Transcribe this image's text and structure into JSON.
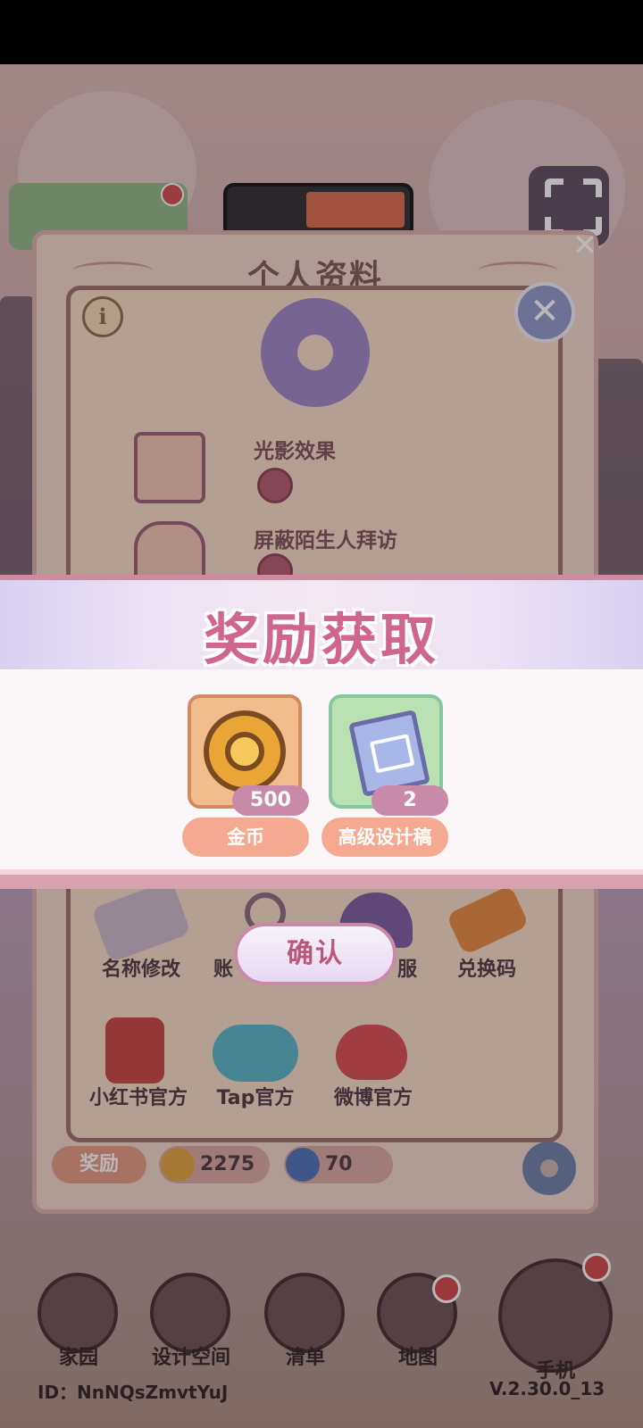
{
  "profile_panel": {
    "title": "个人资料",
    "info_glyph": "i",
    "close_glyph": "✕",
    "settings": [
      {
        "label": "光影效果",
        "icon": "light-switch-icon"
      },
      {
        "label": "屏蔽陌生人拜访",
        "icon": "house-block-icon"
      }
    ],
    "grid_row1": [
      {
        "label": "名称修改",
        "icon": "pencil-icon"
      },
      {
        "label": "账",
        "icon": "account-icon"
      },
      {
        "label": "服",
        "icon": "headset-icon"
      },
      {
        "label": "兑换码",
        "icon": "ticket-icon"
      }
    ],
    "grid_row2": [
      {
        "label": "小红书官方",
        "icon": "red-book-icon"
      },
      {
        "label": "Tap官方",
        "icon": "tap-icon"
      },
      {
        "label": "微博官方",
        "icon": "weibo-icon"
      }
    ],
    "reward_label": "奖励",
    "coins": "2275",
    "swirl": "70"
  },
  "reward_popup": {
    "title": "奖励获取",
    "items": [
      {
        "name": "金币",
        "count": "500",
        "icon": "coin-icon"
      },
      {
        "name": "高级设计稿",
        "count": "2",
        "icon": "design-scroll-icon"
      }
    ],
    "confirm_label": "确认"
  },
  "bottom_nav": [
    {
      "label": "家园",
      "icon": "home-icon"
    },
    {
      "label": "设计空间",
      "icon": "design-space-icon"
    },
    {
      "label": "清单",
      "icon": "checklist-icon"
    },
    {
      "label": "地图",
      "icon": "map-pin-icon"
    },
    {
      "label": "手机",
      "icon": "phone-icon"
    }
  ],
  "footer": {
    "user_id": "ID：NnNQsZmvtYuJ",
    "version": "V.2.30.0_13"
  },
  "colors": {
    "accent_pink": "#d06690",
    "reward_name_bg": "#f4a990",
    "count_badge_bg": "#c88aa8"
  }
}
